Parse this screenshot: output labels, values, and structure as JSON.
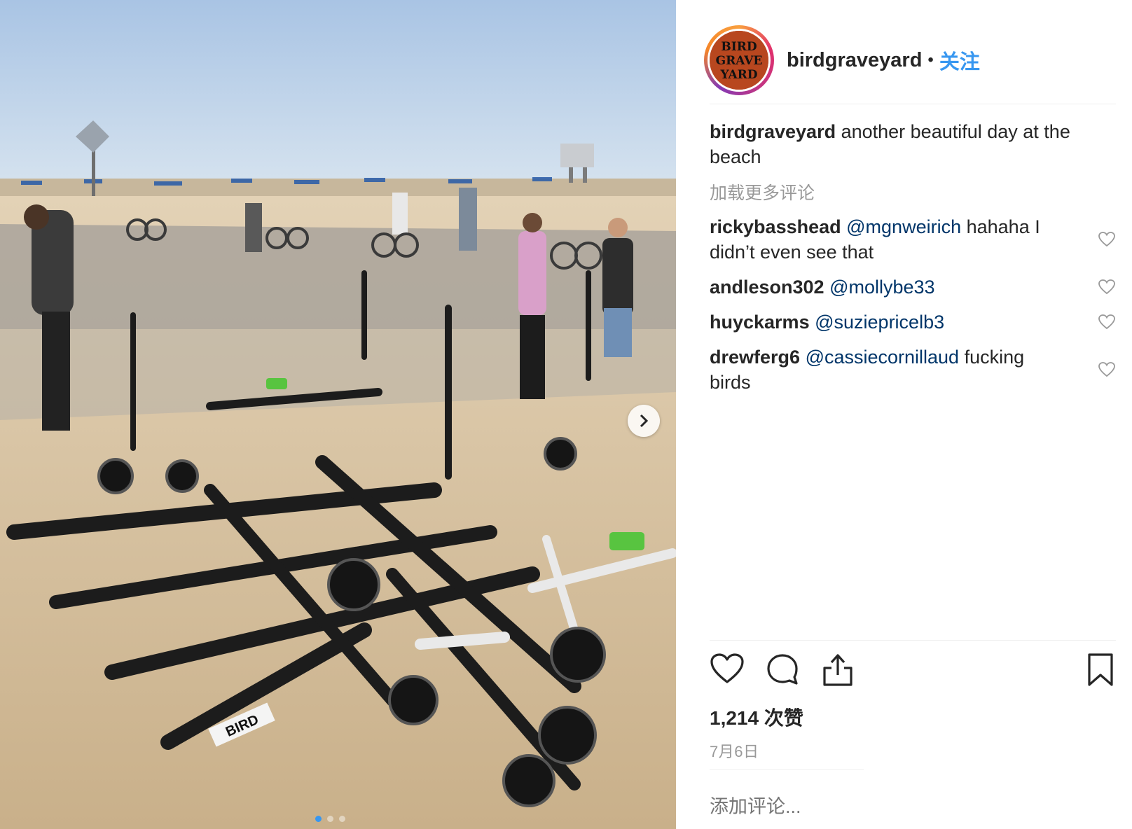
{
  "post": {
    "username": "birdgraveyard",
    "separator": "•",
    "follow_label": "关注",
    "avatar_text": [
      "BIRD",
      "GRAVE",
      "YARD"
    ],
    "caption_username": "birdgraveyard",
    "caption_text": "another beautiful day at the beach",
    "load_more_label": "加载更多评论",
    "likes_label": "1,214 次赞",
    "date_label": "7月6日",
    "add_comment_placeholder": "添加评论..."
  },
  "comments": [
    {
      "username": "rickybasshead",
      "mention": "@mgnweirich",
      "text": "hahaha I didn’t even see that"
    },
    {
      "username": "andleson302",
      "mention": "@mollybe33",
      "text": ""
    },
    {
      "username": "huyckarms",
      "mention": "@suziepricelb3",
      "text": ""
    },
    {
      "username": "drewferg6",
      "mention": "@cassiecornillaud",
      "text": "fucking birds"
    }
  ],
  "photo": {
    "scooter_brand_text": "BIRD",
    "carousel_count": 3,
    "carousel_active_index": 0
  },
  "icons": {
    "like": "heart-outline-icon",
    "comment": "speech-bubble-icon",
    "share": "share-upload-icon",
    "save": "bookmark-icon",
    "next": "chevron-right-icon"
  },
  "colors": {
    "link_blue": "#3897f0",
    "mention_blue": "#003569",
    "muted_gray": "#999999",
    "text_dark": "#262626"
  }
}
